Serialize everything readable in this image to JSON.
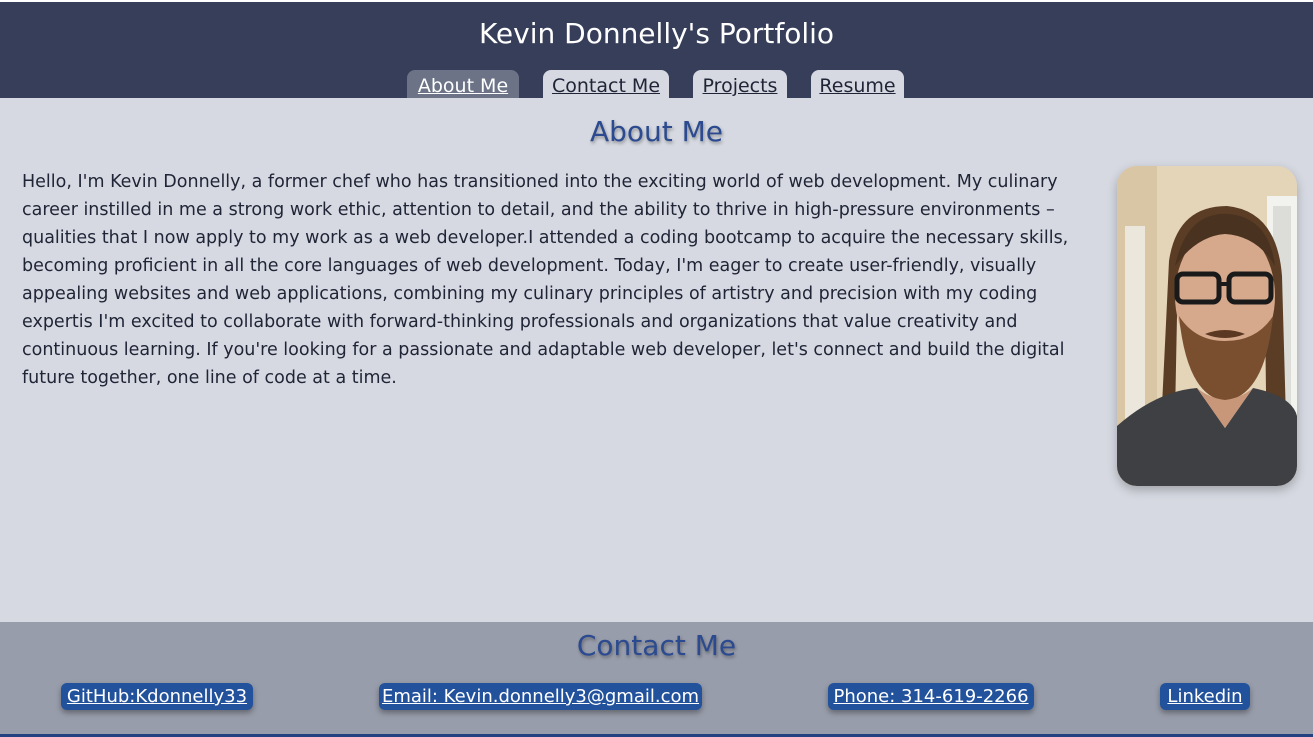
{
  "header": {
    "title": "Kevin Donnelly's Portfolio",
    "tabs": [
      {
        "label": "About Me",
        "active": true
      },
      {
        "label": "Contact Me",
        "active": false
      },
      {
        "label": "Projects",
        "active": false
      },
      {
        "label": "Resume",
        "active": false
      }
    ]
  },
  "about": {
    "heading": "About Me",
    "bio": "Hello, I'm Kevin Donnelly, a former chef who has transitioned into the exciting world of web development. My culinary career instilled in me a strong work ethic, attention to detail, and the ability to thrive in high-pressure environments – qualities that I now apply to my work as a web developer.I attended a coding bootcamp to acquire the necessary skills, becoming proficient in all the core languages of web development. Today, I'm eager to create user-friendly, visually appealing websites and web applications, combining my culinary principles of artistry and precision with my coding expertis I'm excited to collaborate with forward-thinking professionals and organizations that value creativity and continuous learning. If you're looking for a passionate and adaptable web developer, let's connect and build the digital future together, one line of code at a time.",
    "photo_icon": "profile-photo"
  },
  "contact": {
    "heading": "Contact Me",
    "links": {
      "github": "GitHub:Kdonnelly33",
      "email": "Email: Kevin.donnelly3@gmail.com",
      "phone": "Phone: 314-619-2266",
      "linkedin": "Linkedin"
    }
  },
  "colors": {
    "header_bg": "#363e5a",
    "main_bg": "#d6d9e1",
    "footer_bg": "#989dab",
    "accent": "#2b4a8f",
    "link_bg": "#23529c"
  }
}
